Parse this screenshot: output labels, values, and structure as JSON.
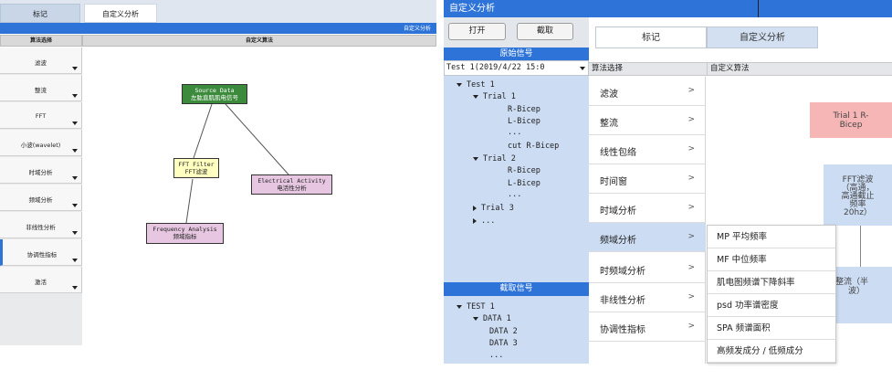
{
  "left": {
    "tabs": [
      "标记",
      "自定义分析"
    ],
    "bluebar_label": "自定义分析",
    "col_algo": "算法选择",
    "col_custom": "自定义算法",
    "algorithms": [
      "滤波",
      "整流",
      "FFT",
      "小波(wavelet)",
      "时域分析",
      "频域分析",
      "非线性分析",
      "协调性指标",
      "激活"
    ],
    "nodes": {
      "source": [
        "Source Data",
        "左肱直肌肌电信号"
      ],
      "fft": [
        "FFT Filter",
        "FFT滤波"
      ],
      "electrical": [
        "Electrical Activity",
        "电活性分析"
      ],
      "frequency": [
        "Frequency Analysis",
        "频域指标"
      ]
    },
    "colors": {
      "source": "#3c8a3c",
      "fft": "#ffffc0",
      "electrical": "#e6c6e0",
      "frequency": "#e6c6e0"
    }
  },
  "right": {
    "title": "自定义分析",
    "buttons": {
      "open": "打开",
      "cut": "截取"
    },
    "source_header": "原始信号",
    "source_select": "Test 1(2019/4/22 15:0",
    "tree": [
      {
        "label": "Test 1",
        "expanded": true
      },
      {
        "label": "Trial 1",
        "expanded": true
      },
      {
        "label": "R-Bicep"
      },
      {
        "label": "L-Bicep"
      },
      {
        "label": "..."
      },
      {
        "label": "cut R-Bicep"
      },
      {
        "label": "Trial 2",
        "expanded": true
      },
      {
        "label": "R-Bicep"
      },
      {
        "label": "L-Bicep"
      },
      {
        "label": "..."
      },
      {
        "label": "Trial 3",
        "expanded": false
      },
      {
        "label": "...",
        "expanded": false
      }
    ],
    "cut_header": "截取信号",
    "cut_tree": [
      {
        "label": "TEST 1",
        "expanded": true
      },
      {
        "label": "DATA 1",
        "expanded": true
      },
      {
        "label": "DATA 2"
      },
      {
        "label": "DATA 3"
      },
      {
        "label": "..."
      }
    ],
    "tabs": {
      "mark": "标记",
      "custom": "自定义分析"
    },
    "col_algo": "算法选择",
    "col_custom": "自定义算法",
    "algorithms": [
      "滤波",
      "整流",
      "线性包络",
      "时间窗",
      "时域分析",
      "频域分析",
      "时频域分析",
      "非线性分析",
      "协调性指标"
    ],
    "selected_algorithm": "频域分析",
    "chevron": ">",
    "submenu": [
      "MP 平均频率",
      "MF 中位频率",
      "肌电图频谱下降斜率",
      "psd 功率谱密度",
      "SPA 频谱面积",
      "高频发成分 / 低频成分"
    ],
    "nodes": {
      "trial": [
        "Trial 1 R-",
        "Bicep"
      ],
      "fft": [
        "FFT滤波",
        "（高通，",
        "高通截止",
        "频率",
        "20hz）"
      ],
      "rect": [
        "整流（半",
        "波）"
      ]
    },
    "colors": {
      "accent": "#2e74d8",
      "panel": "#ccdcf3",
      "trial_node": "#f7b6b6"
    }
  }
}
